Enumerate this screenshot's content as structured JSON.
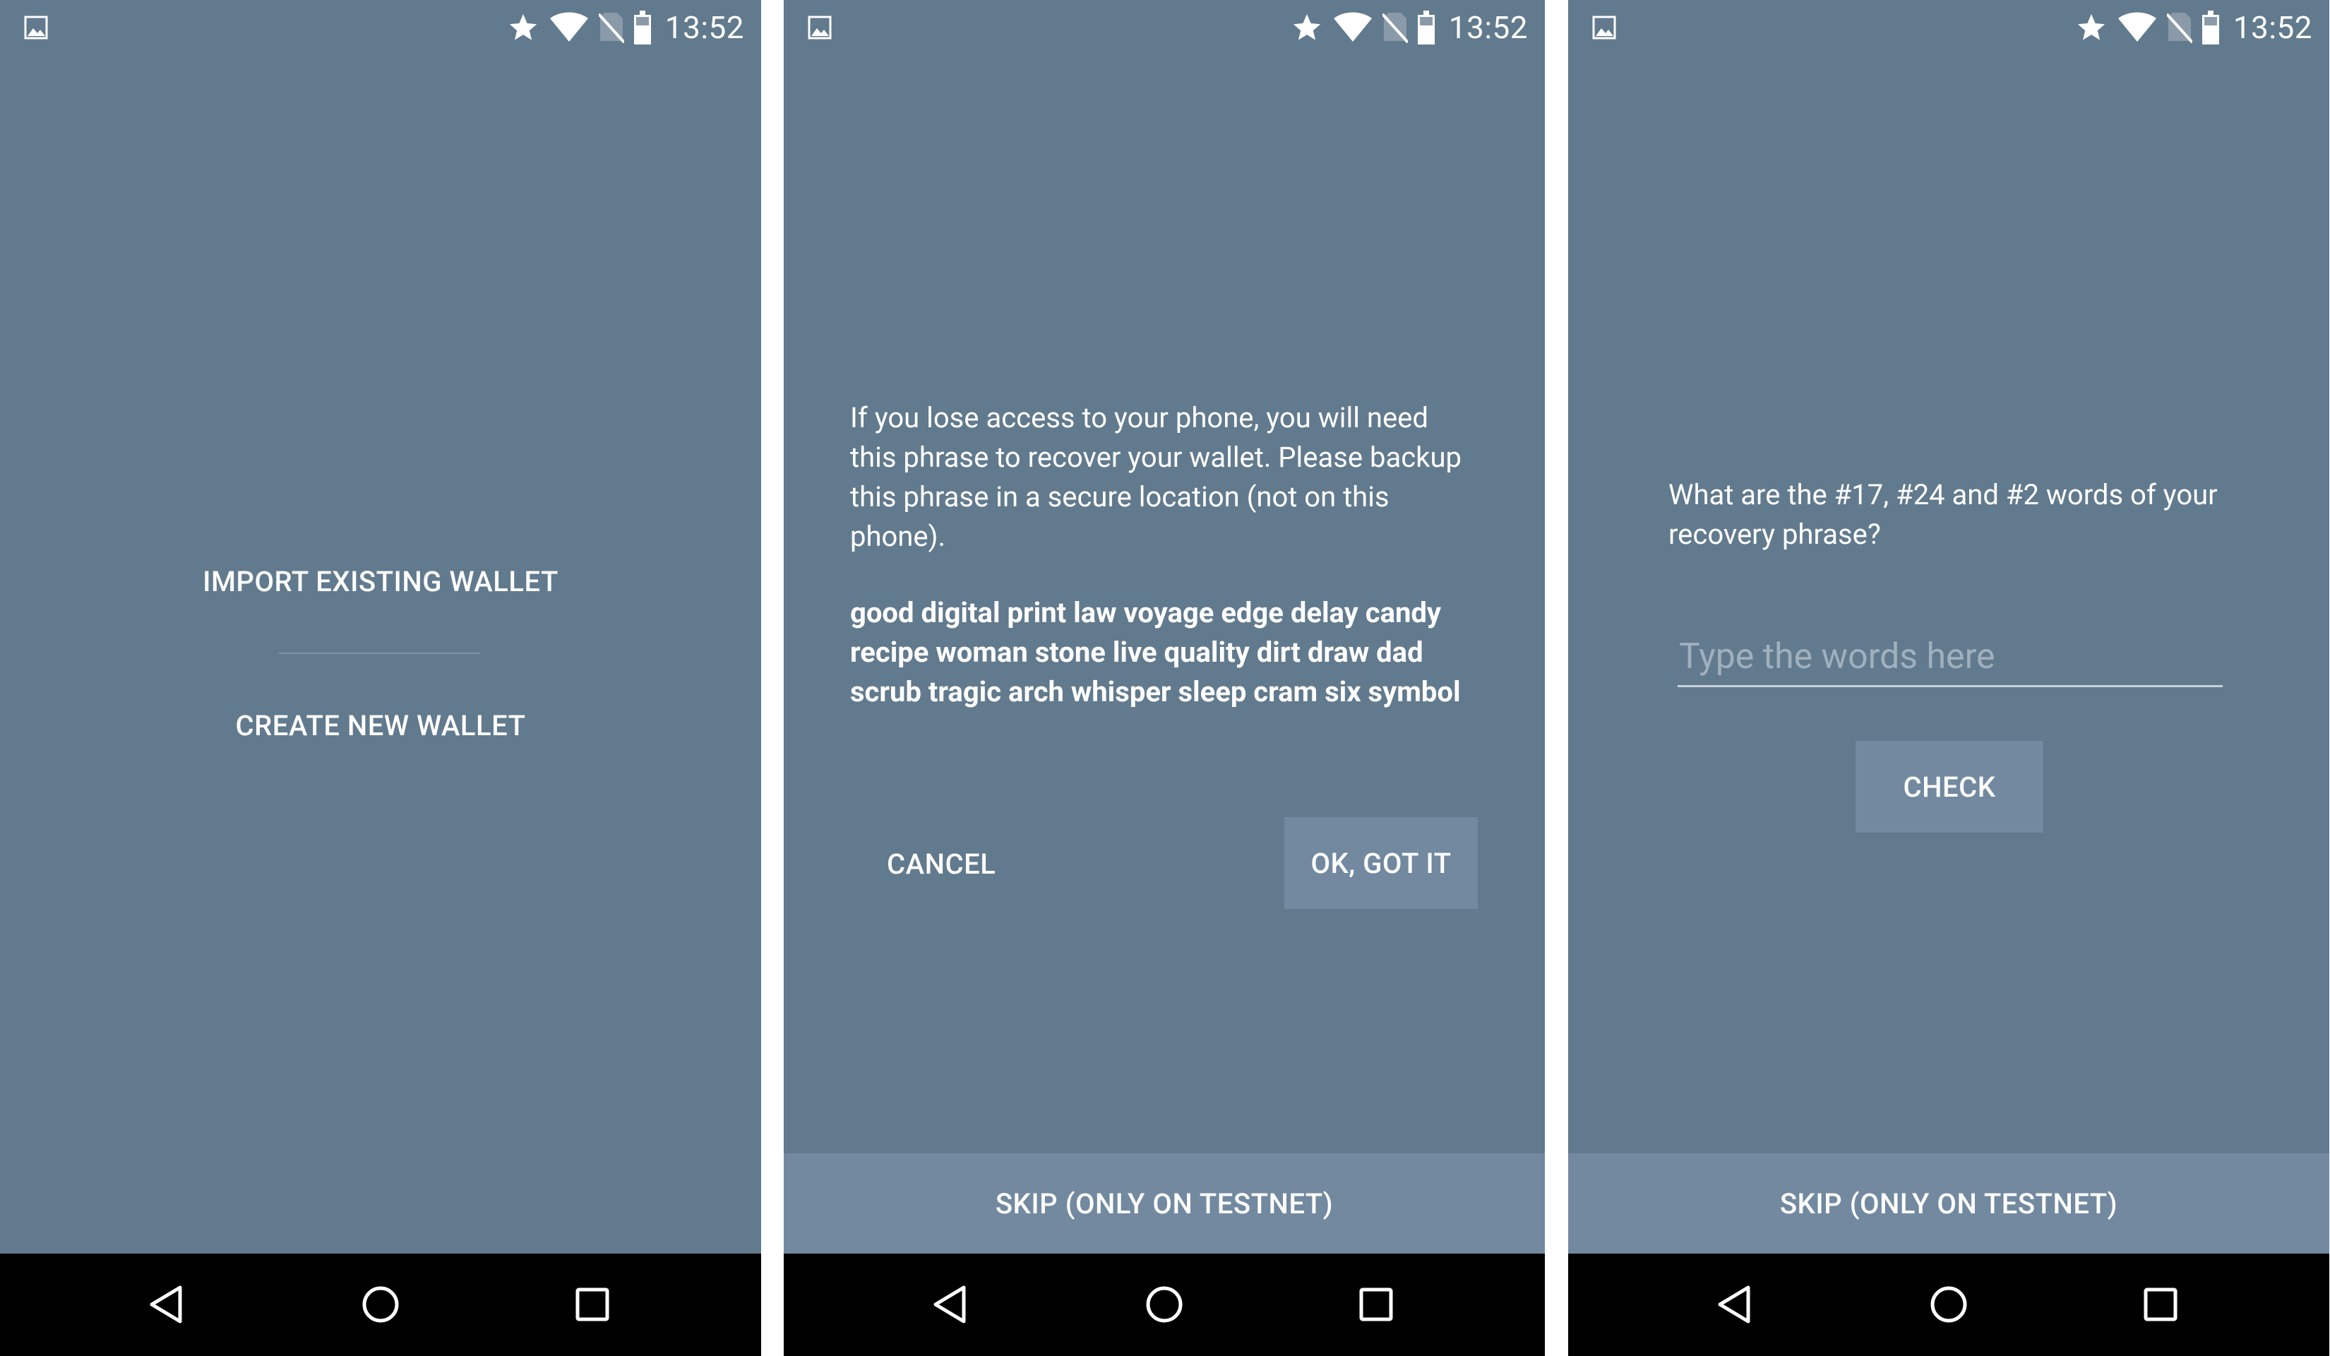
{
  "status": {
    "time": "13:52"
  },
  "screen1": {
    "import_label": "IMPORT EXISTING WALLET",
    "create_label": "CREATE NEW WALLET"
  },
  "screen2": {
    "message": "If you lose access to your phone, you will need this phrase to recover your wallet. Please backup this phrase in a secure location (not on this phone).",
    "phrase": "good digital print law voyage edge delay candy recipe woman stone live quality dirt draw dad scrub tragic arch whisper sleep cram six symbol",
    "cancel_label": "CANCEL",
    "ok_label": "OK, GOT IT",
    "skip_label": "SKIP (ONLY ON TESTNET)"
  },
  "screen3": {
    "question": "What are the #17, #24 and #2 words of your recovery phrase?",
    "input_placeholder": "Type the words here",
    "check_label": "CHECK",
    "skip_label": "SKIP (ONLY ON TESTNET)"
  },
  "icons": {
    "status_left": "gallery-icon",
    "status_right": [
      "star-icon",
      "wifi-icon",
      "no-sim-icon",
      "battery-icon"
    ],
    "nav": [
      "back-icon",
      "home-icon",
      "recents-icon"
    ]
  },
  "colors": {
    "background": "#627a8d",
    "button": "#7289a0",
    "navbar": "#000000",
    "text": "#ffffff"
  }
}
